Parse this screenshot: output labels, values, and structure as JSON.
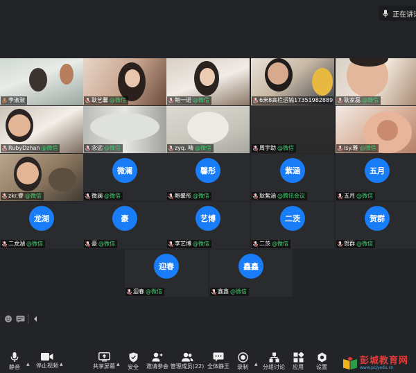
{
  "speaking": {
    "label": "正在讲话",
    "icon": "microphone-icon"
  },
  "accent_color": "#1a7df8",
  "wechat_tag_color": "#3cd070",
  "participants": [
    {
      "name": "李淑淑",
      "tag": "",
      "mic": "unmuted",
      "type": "video"
    },
    {
      "name": "耿艺馨",
      "tag": "@微信",
      "mic": "muted",
      "type": "video"
    },
    {
      "name": "鲍一诺",
      "tag": "@微信",
      "mic": "muted",
      "type": "video"
    },
    {
      "name": "6米8高栏运输17351982889",
      "tag": "",
      "mic": "muted",
      "type": "video"
    },
    {
      "name": "耿家磊",
      "tag": "@微信",
      "mic": "muted",
      "type": "video"
    },
    {
      "name": "RubyDzhan",
      "tag": "@微信",
      "mic": "muted",
      "type": "video"
    },
    {
      "name": "念远",
      "tag": "@微信",
      "mic": "muted",
      "type": "video"
    },
    {
      "name": "zyq. 晴",
      "tag": "@微信",
      "mic": "muted",
      "type": "video"
    },
    {
      "name": "周宇助",
      "tag": "@微信",
      "mic": "muted",
      "type": "video"
    },
    {
      "name": "lsy.雅",
      "tag": "@微信",
      "mic": "muted",
      "type": "video"
    },
    {
      "name": "zkr.睿",
      "tag": "@微信",
      "mic": "muted",
      "type": "video"
    },
    {
      "name": "微澜",
      "tag": "@微信",
      "mic": "muted",
      "type": "avatar",
      "avatar_text": "微澜"
    },
    {
      "name": "鲍馨彤",
      "tag": "@微信",
      "mic": "muted",
      "type": "avatar",
      "avatar_text": "馨彤"
    },
    {
      "name": "耿紫涵",
      "tag": "@腾讯会议",
      "mic": "muted",
      "type": "avatar",
      "avatar_text": "紫涵"
    },
    {
      "name": "五月",
      "tag": "@微信",
      "mic": "muted",
      "type": "avatar",
      "avatar_text": "五月"
    },
    {
      "name": "二龙湖",
      "tag": "@微信",
      "mic": "muted",
      "type": "avatar",
      "avatar_text": "龙湖"
    },
    {
      "name": "豪",
      "tag": "@微信",
      "mic": "muted",
      "type": "avatar",
      "avatar_text": "豪"
    },
    {
      "name": "李艺博",
      "tag": "@微信",
      "mic": "muted",
      "type": "avatar",
      "avatar_text": "艺博"
    },
    {
      "name": "二茨",
      "tag": "@微信",
      "mic": "muted",
      "type": "avatar",
      "avatar_text": "二茨"
    },
    {
      "name": "贺群",
      "tag": "@微信",
      "mic": "muted",
      "type": "avatar",
      "avatar_text": "贺群"
    },
    {
      "name": "迎春",
      "tag": "@微信",
      "mic": "muted",
      "type": "avatar",
      "avatar_text": "迎春"
    },
    {
      "name": "鑫鑫",
      "tag": "@微信",
      "mic": "muted",
      "type": "avatar",
      "avatar_text": "鑫鑫"
    }
  ],
  "chat_bar": {
    "icons": [
      "emoji-icon",
      "chat-icon",
      "collapse-left-icon"
    ]
  },
  "toolbar": {
    "unmute": "静音",
    "stop_video": "停止视频",
    "share_screen": "共享屏幕",
    "security": "安全",
    "invite": "邀请参会",
    "manage": "管理成员(22)",
    "chat": "全体静王",
    "record": "录制",
    "breakout": "分组讨论",
    "apps": "应用",
    "settings": "设置"
  },
  "brand": {
    "name": "彭城教育网",
    "url": "www.pcjyedu.cn"
  }
}
